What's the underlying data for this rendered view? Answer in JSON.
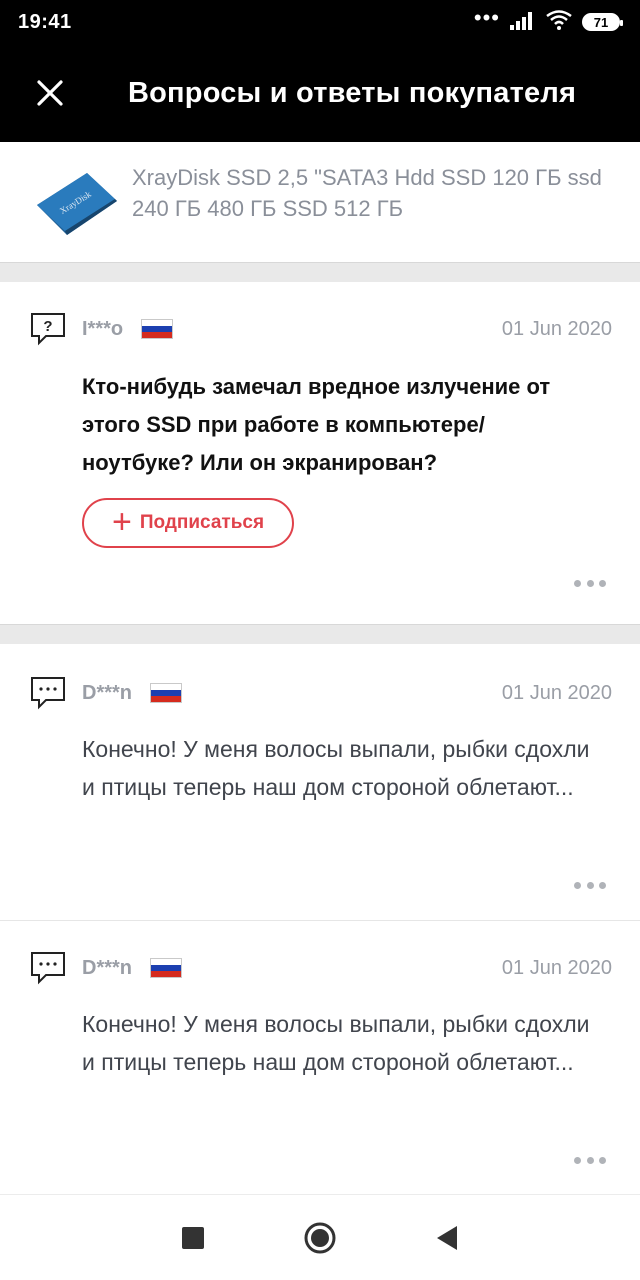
{
  "status_bar": {
    "time": "19:41",
    "battery": "71",
    "icons": [
      "dots-icon",
      "signal-icon",
      "wifi-icon",
      "battery-icon"
    ]
  },
  "header": {
    "title": "Вопросы и ответы покупателя",
    "close_icon": "close-icon"
  },
  "product": {
    "title": "XrayDisk SSD 2,5 \"SATA3 Hdd SSD 120 ГБ ssd 240 ГБ 480 ГБ SSD 512 ГБ",
    "thumb_label": "XrayDisk"
  },
  "question": {
    "user": "I***o",
    "date": "01 Jun 2020",
    "text": "Кто-нибудь замечал вредное излучение от этого SSD при работе в компьютере/ноутбуке? Или он экранирован?",
    "follow_label": "Подписаться",
    "icon": "question-bubble-icon"
  },
  "answers": [
    {
      "user": "D***n",
      "date": "01 Jun 2020",
      "text": "Конечно! У меня волосы выпали, рыбки сдохли и птицы теперь наш дом стороной облетают...",
      "icon": "answer-bubble-icon"
    },
    {
      "user": "D***n",
      "date": "01 Jun 2020",
      "text": "Конечно! У меня волосы выпали, рыбки сдохли и птицы теперь наш дом стороной облетают...",
      "icon": "answer-bubble-icon"
    }
  ],
  "colors": {
    "accent": "#e0424b",
    "flag_white": "#ffffff",
    "flag_blue": "#1c3fb0",
    "flag_red": "#d52b1e",
    "product_blue": "#2a6fa8"
  },
  "nav_bar": {
    "buttons": [
      "recent-apps-icon",
      "home-icon",
      "back-icon"
    ]
  }
}
